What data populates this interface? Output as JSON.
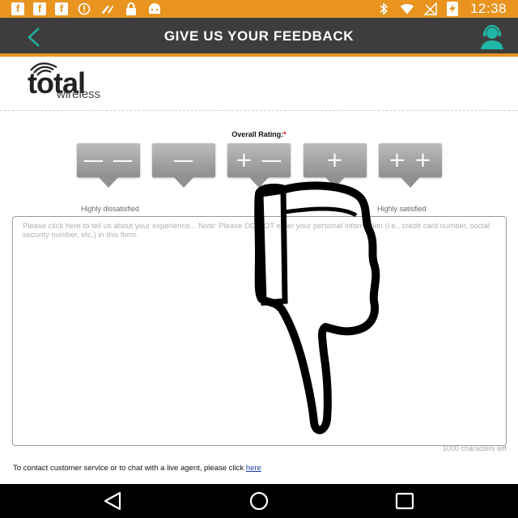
{
  "status_bar": {
    "time": "12:38",
    "left_icons": [
      "facebook-icon",
      "facebook-icon",
      "facebook-icon",
      "alert-circle-icon",
      "app-tool-icon",
      "lock-icon",
      "android-icon"
    ],
    "right_icons": [
      "bluetooth-icon",
      "wifi-icon",
      "no-signal-icon",
      "battery-charging-icon"
    ],
    "fb_glyph": "f",
    "info_glyph": "!",
    "lock_glyph": "🔒",
    "tool_glyph": "✗"
  },
  "app_bar": {
    "title": "GIVE US YOUR FEEDBACK"
  },
  "logo": {
    "total": "total",
    "wireless": "wireless"
  },
  "rating": {
    "label": "Overall Rating:",
    "required_mark": "*",
    "options": [
      {
        "symbol": "— —"
      },
      {
        "symbol": "—"
      },
      {
        "symbol": "+ —"
      },
      {
        "symbol": "+"
      },
      {
        "symbol": "+ +"
      }
    ],
    "low_label": "Highly dissatisfied",
    "high_label": "Highly satisfied"
  },
  "feedback": {
    "placeholder": "Please click here to tell us about your experience... Note: Please DO NOT enter your personal information (i.e., credit card number, social security number, etc.) in this form.",
    "char_count": "1000 characters left"
  },
  "contact": {
    "text": "To contact customer service or to chat with a live agent, please click ",
    "link": "here"
  },
  "colors": {
    "status_bar": "#e8941f",
    "app_bar": "#3d3d3d",
    "accent_teal": "#1fb7a6"
  }
}
